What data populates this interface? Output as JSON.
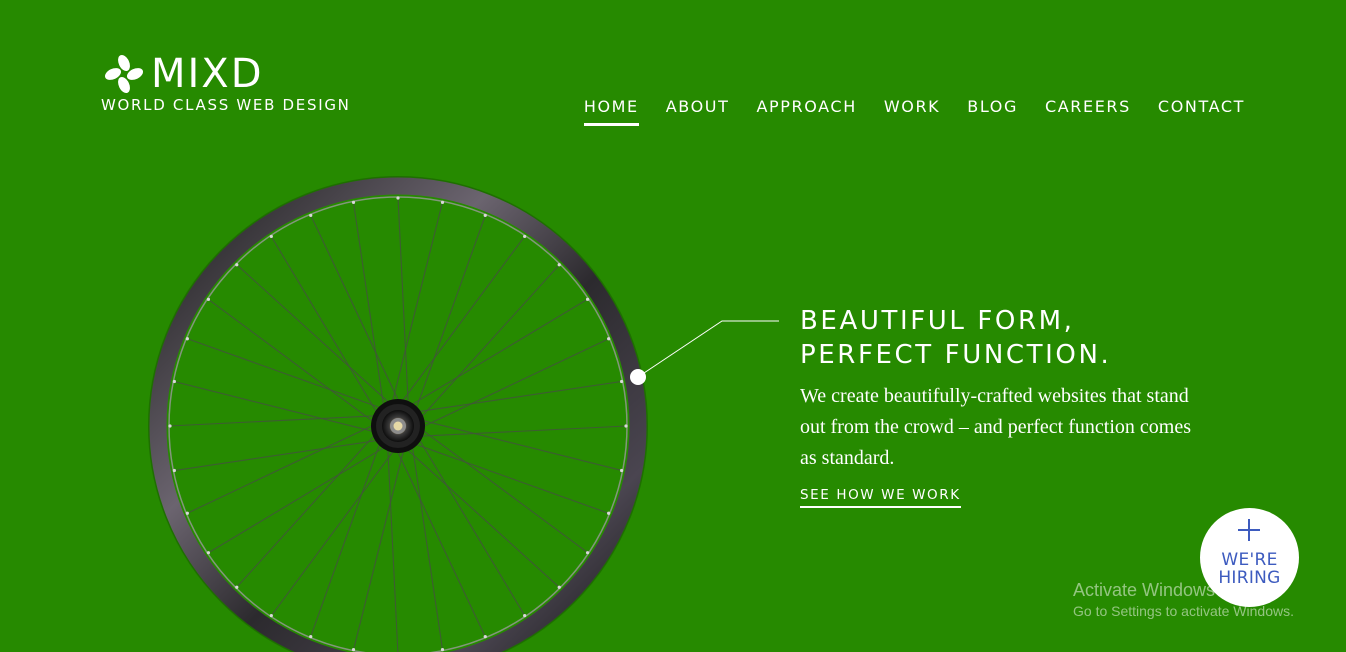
{
  "brand": {
    "name": "MIXD",
    "tagline": "WORLD CLASS WEB DESIGN",
    "logo_icon": "pinwheel-icon"
  },
  "nav": {
    "items": [
      {
        "label": "HOME",
        "active": true
      },
      {
        "label": "ABOUT"
      },
      {
        "label": "APPROACH"
      },
      {
        "label": "WORK"
      },
      {
        "label": "BLOG"
      },
      {
        "label": "CAREERS"
      },
      {
        "label": "CONTACT"
      }
    ]
  },
  "hero": {
    "title_line1": "BEAUTIFUL FORM,",
    "title_line2": "PERFECT FUNCTION.",
    "description": "We create beautifully-crafted websites that stand out from the crowd – and perfect function comes as standard.",
    "cta": "SEE HOW WE WORK",
    "image": "bicycle-wheel"
  },
  "hiring_badge": {
    "icon": "plus-icon",
    "line1": "WE'RE",
    "line2": "HIRING"
  },
  "watermark": {
    "title": "Activate Windows",
    "subtitle": "Go to Settings to activate Windows."
  },
  "colors": {
    "background": "#268a00",
    "text": "#ffffff",
    "badge_text": "#3d5bbf"
  }
}
